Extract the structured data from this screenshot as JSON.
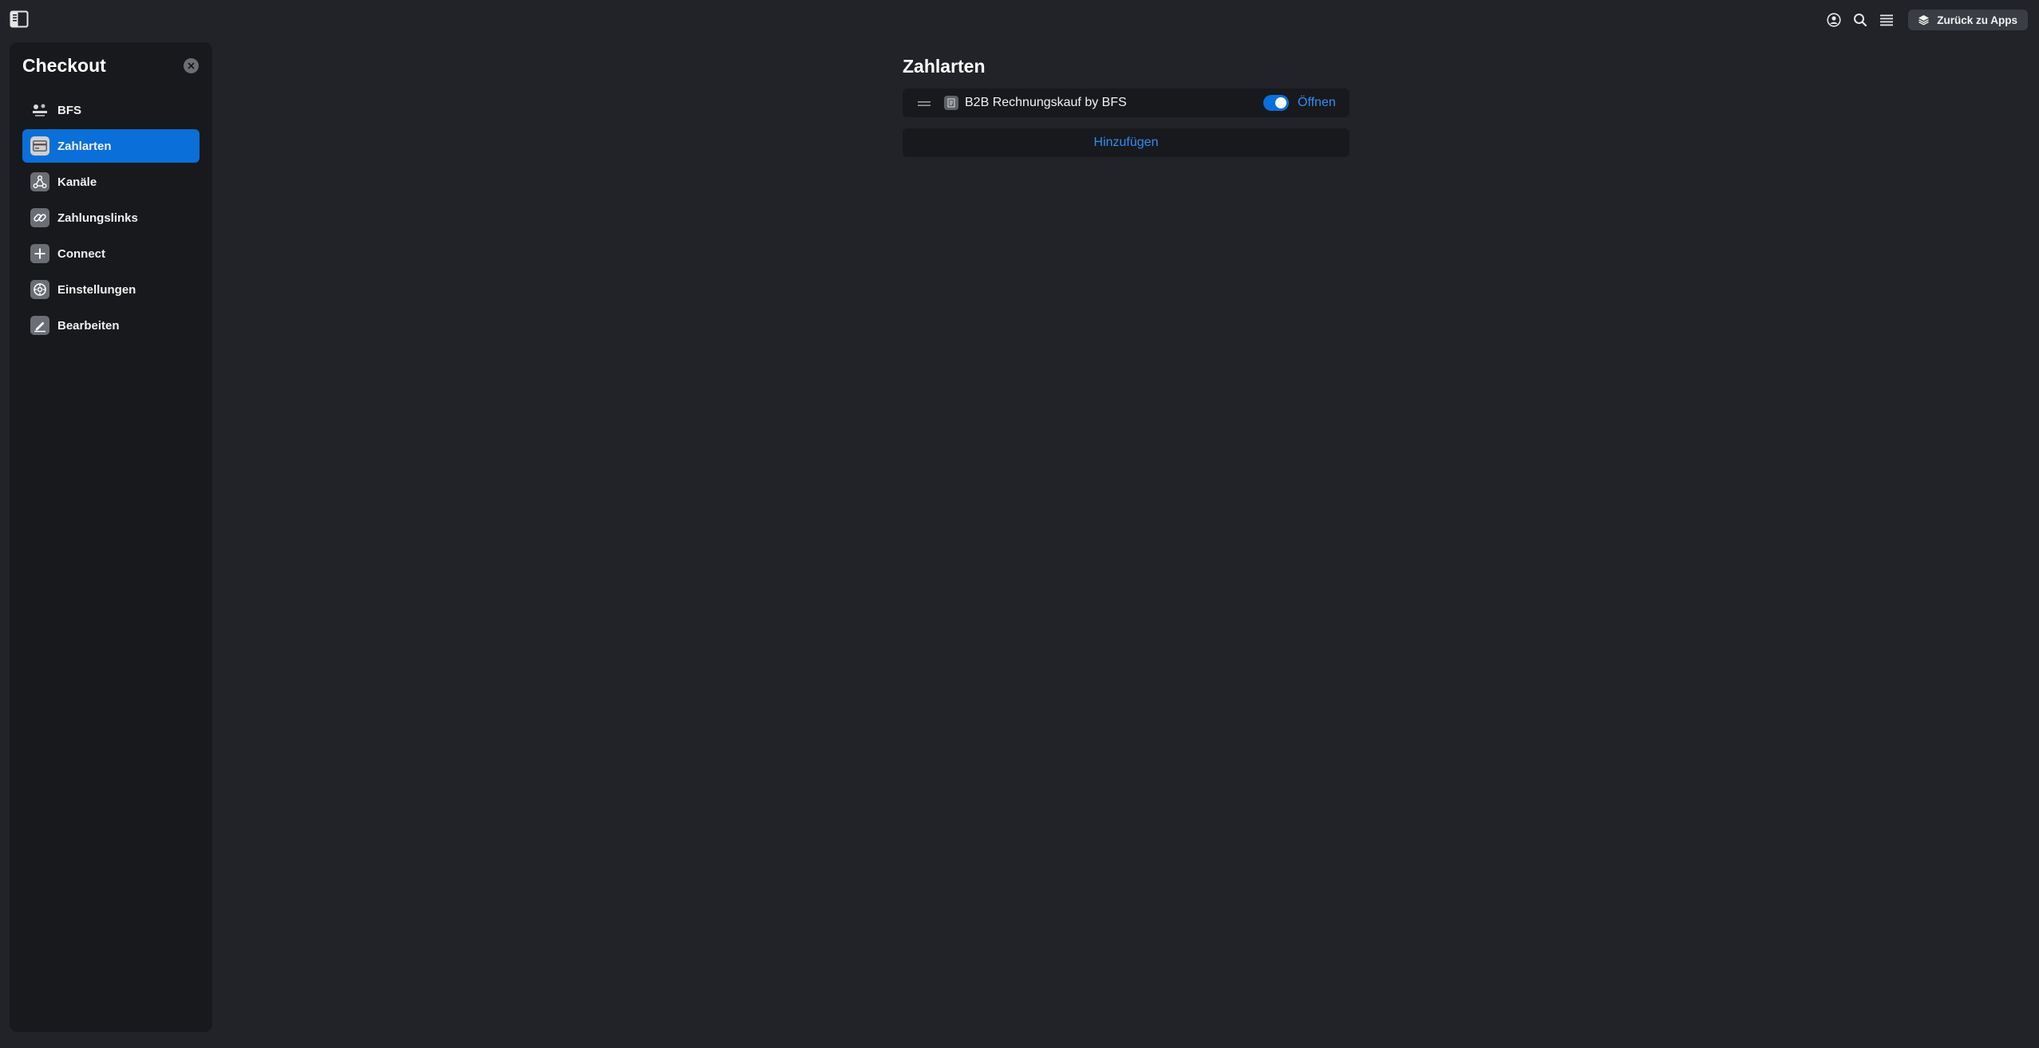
{
  "topbar": {
    "back_label": "Zurück zu Apps",
    "icons": [
      "sidebar-toggle-icon",
      "account-icon",
      "search-icon",
      "menu-icon",
      "apps-stack-icon"
    ]
  },
  "sidebar": {
    "title": "Checkout",
    "items": [
      {
        "label": "BFS",
        "icon": "bfs-logo-icon",
        "active": false
      },
      {
        "label": "Zahlarten",
        "icon": "card-icon",
        "active": true
      },
      {
        "label": "Kanäle",
        "icon": "channels-icon",
        "active": false
      },
      {
        "label": "Zahlungslinks",
        "icon": "link-icon",
        "active": false
      },
      {
        "label": "Connect",
        "icon": "plus-icon",
        "active": false
      },
      {
        "label": "Einstellungen",
        "icon": "settings-icon",
        "active": false
      },
      {
        "label": "Bearbeiten",
        "icon": "edit-icon",
        "active": false
      }
    ]
  },
  "main": {
    "title": "Zahlarten",
    "payment_methods": [
      {
        "name": "B2B Rechnungskauf by BFS",
        "enabled": true,
        "open_label": "Öffnen"
      }
    ],
    "add_label": "Hinzufügen"
  },
  "colors": {
    "background": "#212328",
    "panel": "#18191c",
    "accent": "#0a6fd9",
    "link": "#2f8ef5"
  }
}
